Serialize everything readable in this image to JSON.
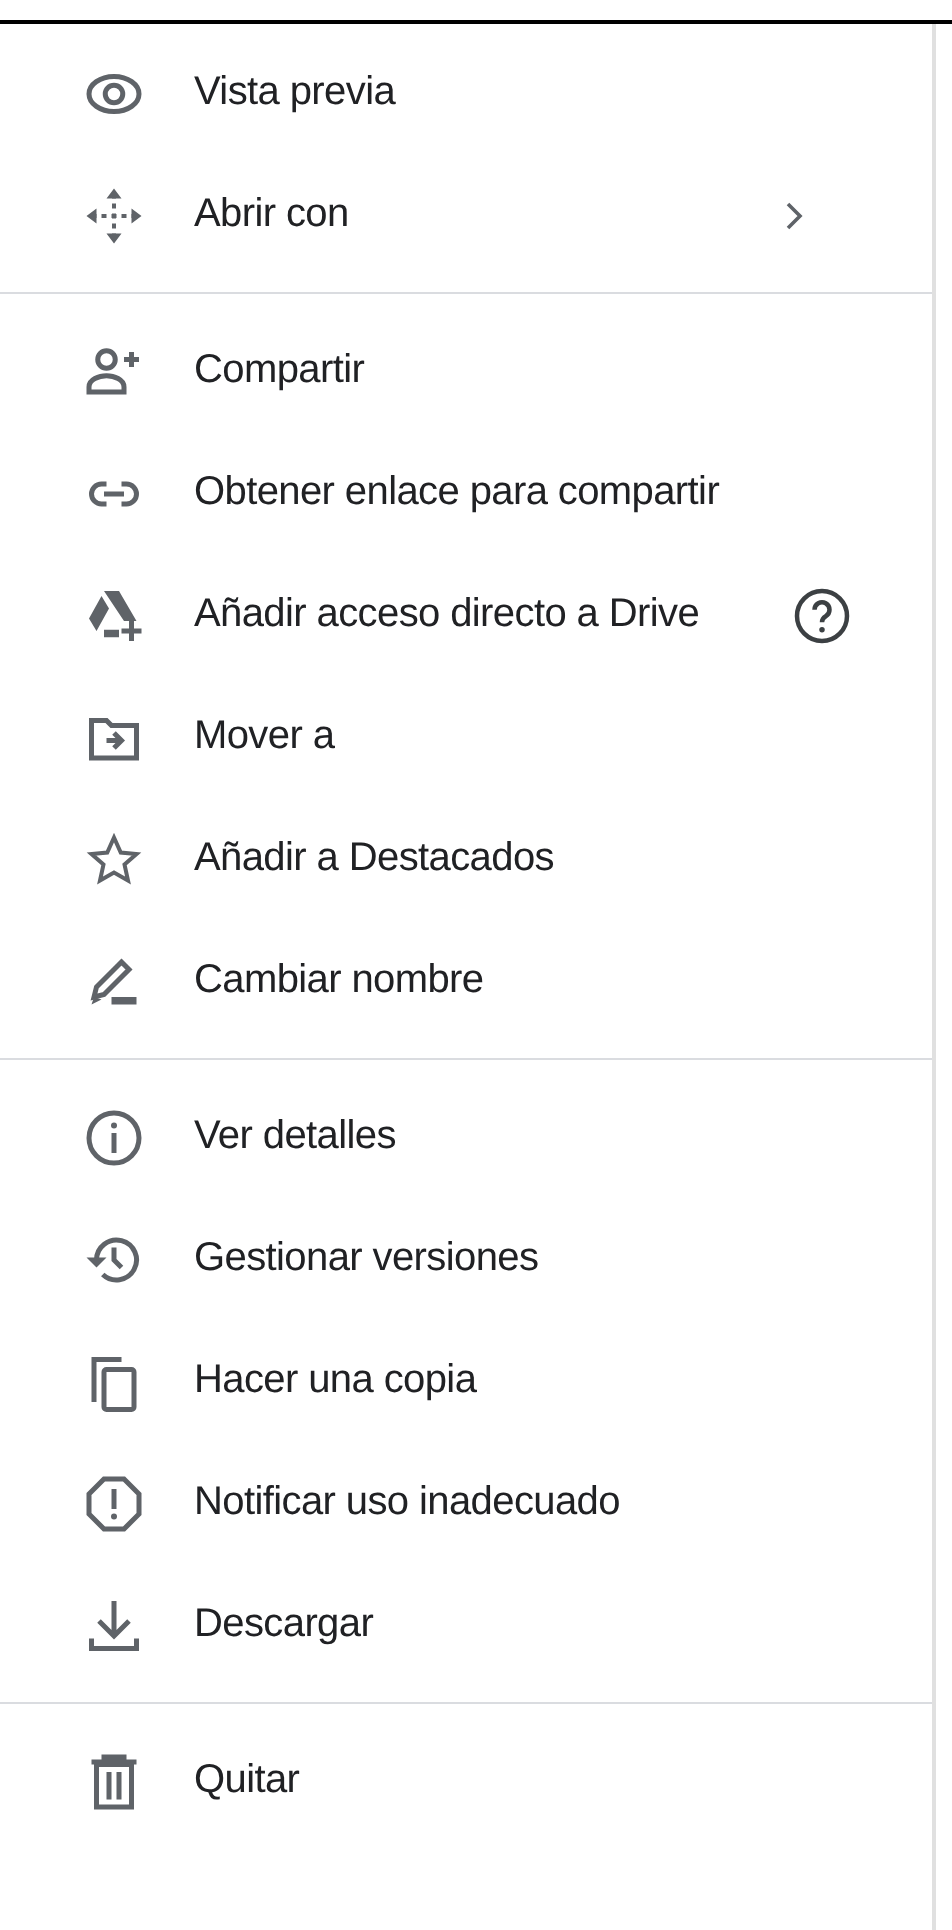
{
  "menu": {
    "sections": [
      {
        "items": [
          {
            "label": "Vista previa",
            "kind": "plain"
          },
          {
            "label": "Abrir con",
            "kind": "submenu"
          }
        ]
      },
      {
        "items": [
          {
            "label": "Compartir",
            "kind": "plain"
          },
          {
            "label": "Obtener enlace para compartir",
            "kind": "plain"
          },
          {
            "label": "Añadir acceso directo a Drive",
            "kind": "help"
          },
          {
            "label": "Mover a",
            "kind": "plain"
          },
          {
            "label": "Añadir a Destacados",
            "kind": "plain"
          },
          {
            "label": "Cambiar nombre",
            "kind": "plain"
          }
        ]
      },
      {
        "items": [
          {
            "label": "Ver detalles",
            "kind": "plain"
          },
          {
            "label": "Gestionar versiones",
            "kind": "plain"
          },
          {
            "label": "Hacer una copia",
            "kind": "plain"
          },
          {
            "label": "Notificar uso inadecuado",
            "kind": "plain"
          },
          {
            "label": "Descargar",
            "kind": "plain"
          }
        ]
      },
      {
        "items": [
          {
            "label": "Quitar",
            "kind": "plain"
          }
        ]
      }
    ]
  }
}
